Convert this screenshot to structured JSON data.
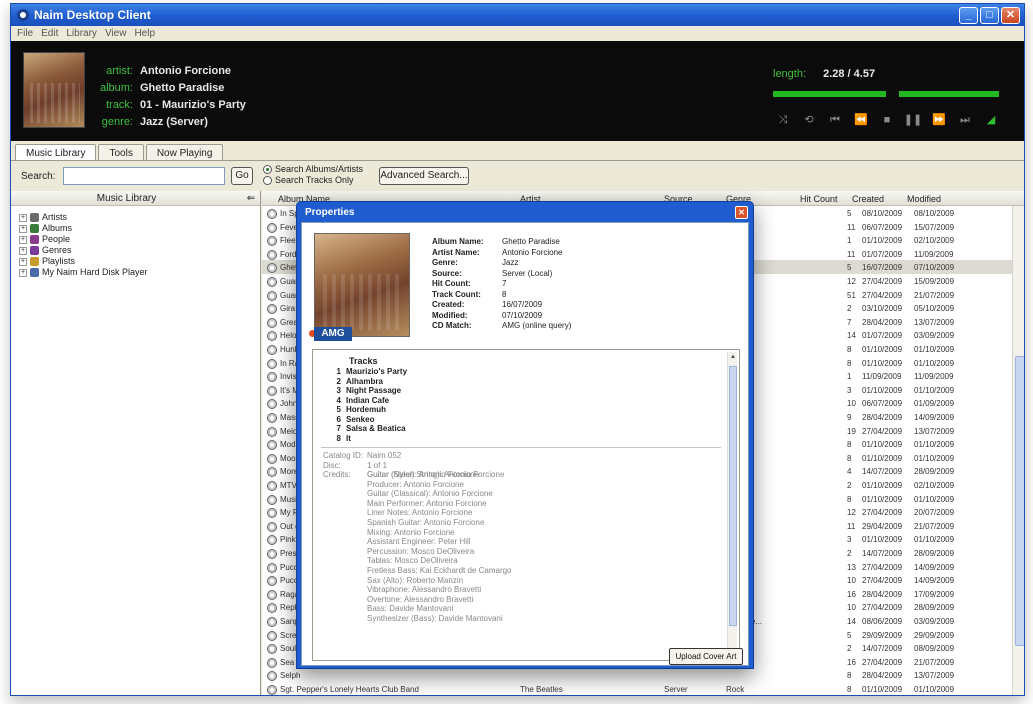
{
  "window": {
    "title": "Naim Desktop Client",
    "minimize": "_",
    "maximize": "□",
    "close": "✕"
  },
  "menu": [
    "File",
    "Edit",
    "Library",
    "View",
    "Help"
  ],
  "now_playing": {
    "artist_label": "artist:",
    "artist": "Antonio Forcione",
    "album_label": "album:",
    "album": "Ghetto Paradise",
    "track_label": "track:",
    "track": "01 - Maurizio's Party",
    "genre_label": "genre:",
    "genre": "Jazz (Server)",
    "length_label": "length:",
    "length": "2.28 / 4.57",
    "progress": 0.49
  },
  "controls": [
    {
      "name": "shuffle-icon",
      "glyph": "⤨"
    },
    {
      "name": "repeat-icon",
      "glyph": "⟲"
    },
    {
      "name": "skip-back-icon",
      "glyph": "⏮"
    },
    {
      "name": "rewind-icon",
      "glyph": "⏪"
    },
    {
      "name": "stop-icon",
      "glyph": "■"
    },
    {
      "name": "pause-icon",
      "glyph": "❚❚"
    },
    {
      "name": "fast-forward-icon",
      "glyph": "⏩"
    },
    {
      "name": "skip-forward-icon",
      "glyph": "⏭"
    },
    {
      "name": "volume-icon",
      "glyph": "◢"
    }
  ],
  "tabs": [
    "Music Library",
    "Tools",
    "Now Playing"
  ],
  "search": {
    "label": "Search:",
    "value": "",
    "go": "Go",
    "option_albums": "Search Albums/Artists",
    "option_tracks": "Search Tracks Only",
    "advanced": "Advanced Search..."
  },
  "library_pane": {
    "title": "Music Library",
    "back": "⇐",
    "tree": [
      "Artists",
      "Albums",
      "People",
      "Genres",
      "Playlists",
      "My Naim Hard Disk Player"
    ]
  },
  "columns": [
    "Album Name",
    "Artist",
    "Source",
    "Genre",
    "Hit Count",
    "Created",
    "Modified"
  ],
  "rows": [
    {
      "name": "In Sp",
      "genre": "",
      "hits": "5",
      "created": "08/10/2009",
      "modified": "08/10/2009"
    },
    {
      "name": "Fever",
      "genre": "gned)",
      "hits": "11",
      "created": "06/07/2009",
      "modified": "15/07/2009"
    },
    {
      "name": "Fleet",
      "genre": "",
      "hits": "1",
      "created": "01/10/2009",
      "modified": "02/10/2009"
    },
    {
      "name": "Ford",
      "genre": "ica",
      "hits": "11",
      "created": "01/07/2009",
      "modified": "11/09/2009"
    },
    {
      "name": "Ghet",
      "genre": "",
      "hits": "5",
      "created": "16/07/2009",
      "modified": "07/10/2009"
    },
    {
      "name": "Guar",
      "genre": "",
      "hits": "12",
      "created": "27/04/2009",
      "modified": "15/09/2009"
    },
    {
      "name": "Guar",
      "genre": "",
      "hits": "51",
      "created": "27/04/2009",
      "modified": "21/07/2009"
    },
    {
      "name": "Gira",
      "genre": "",
      "hits": "2",
      "created": "03/10/2009",
      "modified": "05/10/2009"
    },
    {
      "name": "Great",
      "genre": "",
      "hits": "7",
      "created": "28/04/2009",
      "modified": "13/07/2009"
    },
    {
      "name": "Helo",
      "genre": "",
      "hits": "14",
      "created": "01/07/2009",
      "modified": "03/09/2009"
    },
    {
      "name": "Hunk",
      "genre": "",
      "hits": "8",
      "created": "01/10/2009",
      "modified": "01/10/2009"
    },
    {
      "name": "In Ra",
      "genre": "",
      "hits": "8",
      "created": "01/10/2009",
      "modified": "01/10/2009"
    },
    {
      "name": "Invisi",
      "genre": "",
      "hits": "1",
      "created": "11/09/2009",
      "modified": "11/09/2009"
    },
    {
      "name": "It's M",
      "genre": "",
      "hits": "3",
      "created": "01/10/2009",
      "modified": "01/10/2009"
    },
    {
      "name": "John",
      "genre": "",
      "hits": "10",
      "created": "06/07/2009",
      "modified": "01/09/2009"
    },
    {
      "name": "Mass",
      "genre": "",
      "hits": "9",
      "created": "28/04/2009",
      "modified": "14/09/2009"
    },
    {
      "name": "Melo",
      "genre": "",
      "hits": "19",
      "created": "27/04/2009",
      "modified": "13/07/2009"
    },
    {
      "name": "Modu",
      "genre": "ica",
      "hits": "8",
      "created": "01/10/2009",
      "modified": "01/10/2009"
    },
    {
      "name": "Moon",
      "genre": "ica",
      "hits": "8",
      "created": "01/10/2009",
      "modified": "01/10/2009"
    },
    {
      "name": "More",
      "genre": "",
      "hits": "4",
      "created": "14/07/2009",
      "modified": "28/09/2009"
    },
    {
      "name": "MTV U",
      "genre": "",
      "hits": "2",
      "created": "01/10/2009",
      "modified": "02/10/2009"
    },
    {
      "name": "Music",
      "genre": "ica",
      "hits": "8",
      "created": "01/10/2009",
      "modified": "01/10/2009"
    },
    {
      "name": "My Fr",
      "genre": "gned)",
      "hits": "12",
      "created": "27/04/2009",
      "modified": "20/07/2009"
    },
    {
      "name": "Out o",
      "genre": "",
      "hits": "11",
      "created": "29/04/2009",
      "modified": "21/07/2009"
    },
    {
      "name": "Pink N",
      "genre": "",
      "hits": "3",
      "created": "01/10/2009",
      "modified": "01/10/2009"
    },
    {
      "name": "Prese",
      "genre": "",
      "hits": "2",
      "created": "14/07/2009",
      "modified": "28/09/2009"
    },
    {
      "name": "Pucci",
      "genre": "",
      "hits": "13",
      "created": "27/04/2009",
      "modified": "14/09/2009"
    },
    {
      "name": "Pucci",
      "genre": "",
      "hits": "10",
      "created": "27/04/2009",
      "modified": "14/09/2009"
    },
    {
      "name": "Raga",
      "genre": "",
      "hits": "16",
      "created": "28/04/2009",
      "modified": "17/09/2009"
    },
    {
      "name": "Reph",
      "genre": "gned)",
      "hits": "10",
      "created": "27/04/2009",
      "modified": "28/09/2009"
    },
    {
      "name": "Sanp",
      "genre": "an entre...",
      "hits": "14",
      "created": "08/06/2009",
      "modified": "03/09/2009"
    },
    {
      "name": "Screa",
      "genre": "",
      "hits": "5",
      "created": "29/09/2009",
      "modified": "29/09/2009"
    },
    {
      "name": "Soulb",
      "genre": "",
      "hits": "2",
      "created": "14/07/2009",
      "modified": "08/09/2009"
    },
    {
      "name": "Sea C",
      "genre": "",
      "hits": "16",
      "created": "27/04/2009",
      "modified": "21/07/2009"
    },
    {
      "name": "Selph",
      "genre": "",
      "hits": "8",
      "created": "28/04/2009",
      "modified": "13/07/2009"
    },
    {
      "name": "Sgt. Pepper's Lonely Hearts Club Band",
      "artist": "The Beatles",
      "source": "Server",
      "genre": "Rock",
      "hits": "8",
      "created": "01/10/2009",
      "modified": "01/10/2009"
    }
  ],
  "dialog": {
    "title": "Properties",
    "close": "✕",
    "amg": "AMG",
    "props": [
      {
        "label": "Album Name:",
        "value": "Ghetto Paradise"
      },
      {
        "label": "Artist Name:",
        "value": "Antonio Forcione"
      },
      {
        "label": "Genre:",
        "value": "Jazz"
      },
      {
        "label": "Source:",
        "value": "Server (Local)"
      },
      {
        "label": "Hit Count:",
        "value": "7"
      },
      {
        "label": "Track Count:",
        "value": "8"
      },
      {
        "label": "Created:",
        "value": "16/07/2009"
      },
      {
        "label": "Modified:",
        "value": "07/10/2009"
      },
      {
        "label": "CD Match:",
        "value": "AMG (online query)"
      }
    ],
    "tracks_title": "Tracks",
    "tracks": [
      {
        "n": "1",
        "title": "Maurizio's Party"
      },
      {
        "n": "2",
        "title": "Alhambra"
      },
      {
        "n": "3",
        "title": "Night Passage"
      },
      {
        "n": "4",
        "title": "Indian Cafe"
      },
      {
        "n": "5",
        "title": "Hordemuh"
      },
      {
        "n": "6",
        "title": "Senkeo"
      },
      {
        "n": "7",
        "title": "Salsa & Beatica"
      },
      {
        "n": "8",
        "title": "It"
      }
    ],
    "catalog": [
      {
        "label": "Catalog ID:",
        "value": "Naim 052"
      },
      {
        "label": "Disc:",
        "value": "1 of 1"
      },
      {
        "label": "Credits:",
        "value": "Guitar (Nylon String): Antonio Forcione"
      }
    ],
    "credits": [
      "Guitar (Steel): Antonio Forcione",
      "Producer: Antonio Forcione",
      "Guitar (Classical): Antonio Forcione",
      "Main Performer: Antonio Forcione",
      "Liner Notes: Antonio Forcione",
      "Spanish Guitar: Antonio Forcione",
      "Mixing: Antonio Forcione",
      "Assistant Engineer: Peter Hill",
      "Percussion: Mosco DeOliveira",
      "Tablas: Mosco DeOliveira",
      "Fretless Bass: Kai Eckhardt de Camargo",
      "Sax (Alto): Roberto Manzin",
      "Vibraphone: Alessandro Bravetti",
      "Overtone: Alessandro Bravetti",
      "Bass: Davide Mantovani",
      "Synthesizer (Bass): Davide Mantovani"
    ],
    "upload": "Upload Cover Art"
  }
}
